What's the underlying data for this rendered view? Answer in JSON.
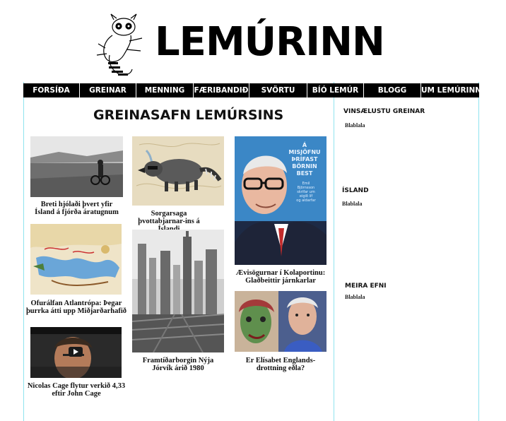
{
  "site": {
    "title": "LEMÚRINN"
  },
  "nav": [
    {
      "label": "FORSÍÐA"
    },
    {
      "label": "GREINAR"
    },
    {
      "label": "MENNING"
    },
    {
      "label": "FÆRIBANDIÐ"
    },
    {
      "label": "SVÖRTU"
    },
    {
      "label": "BÍÓ LEMÚR"
    },
    {
      "label": "BLOGG"
    },
    {
      "label": "UM LEMÚRINN"
    }
  ],
  "main": {
    "title": "GREINASAFN LEMÚRSINS",
    "articles": [
      {
        "caption": "Breti hjólaði þvert yfir Ísland á fjórða áratugnum"
      },
      {
        "caption": "Sorgarsaga þvottabjarnar-ins á Íslandi"
      },
      {
        "caption": "Ævisögurnar í Kolaportinu: Glaðbeittir járnkarlar"
      },
      {
        "caption": "Ofurálfan Atlantrópa: Þegar þurrka átti upp Miðjarðarhafið"
      },
      {
        "caption": "Framtíðarborgin Nýja Jórvík árið 1980"
      },
      {
        "caption": "Er Elísabet Englands-drottning eðla?"
      },
      {
        "caption": "Nicolas Cage flytur verkið 4,33 eftir John Cage"
      }
    ],
    "book_cover": {
      "line1": "Á",
      "line2": "MISJÖFNU",
      "line3": "ÞRÍFAST",
      "line4": "BÖRNIN",
      "line5": "BEST",
      "sub1": "Emil",
      "sub2": "Björnsson",
      "sub3": "skrifar um",
      "sub4": "eigið líf",
      "sub5": "og aldarfar"
    }
  },
  "sidebar": {
    "popular": {
      "heading": "VINSÆLUSTU GREINAR",
      "text": "Blablala"
    },
    "island": {
      "heading": "ÍSLAND",
      "text": "Blablala"
    },
    "more": {
      "heading": "MEIRA EFNI",
      "text": "Blablala"
    }
  },
  "colors": {
    "nav_bg": "#000000",
    "guide": "#8fe3ef",
    "book_blue": "#2a7fc1",
    "book_text": "#e8f3ff"
  }
}
